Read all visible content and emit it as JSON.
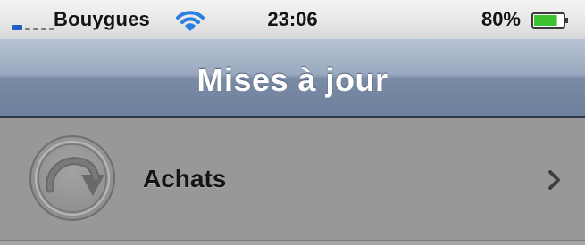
{
  "status_bar": {
    "carrier": "Bouygues",
    "time": "23:06",
    "battery": "80%",
    "battery_level": 0.8,
    "signal_icon": "signal-bars-icon",
    "wifi_icon": "wifi-icon"
  },
  "nav_bar": {
    "title": "Mises à jour"
  },
  "list": {
    "items": [
      {
        "label": "Achats",
        "icon": "download-arrow-icon",
        "accessory": "chevron-right-icon"
      }
    ]
  }
}
